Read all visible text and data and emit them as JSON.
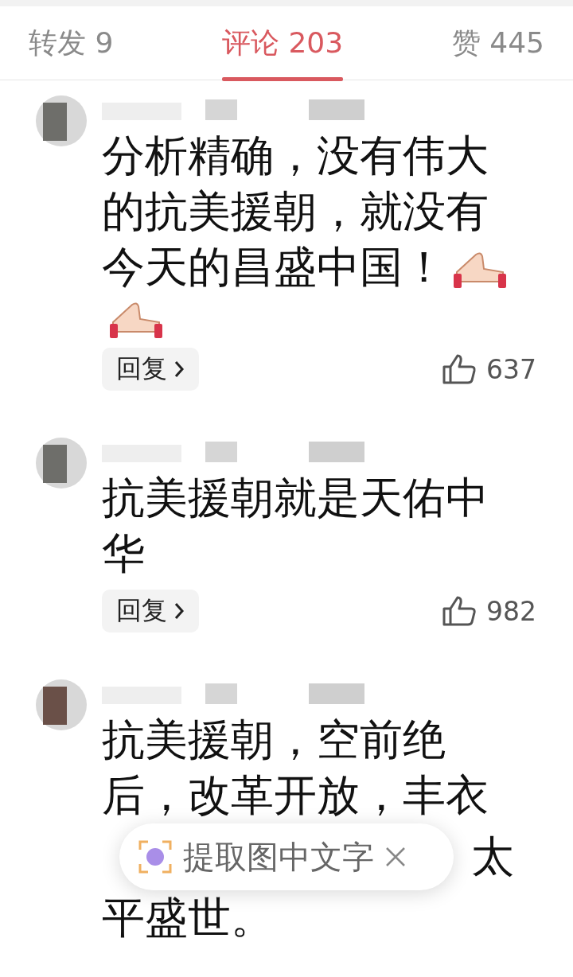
{
  "tabs": [
    {
      "label": "转发 9",
      "selected": false
    },
    {
      "label": "评论 203",
      "selected": true
    },
    {
      "label": "赞 445",
      "selected": false
    }
  ],
  "comments": [
    {
      "lines": [
        {
          "kind": "text",
          "text": "分析精确，没有伟大",
          "emoji": false
        },
        {
          "kind": "text",
          "text": "的抗美援朝，就没有",
          "emoji": false
        },
        {
          "kind": "text",
          "text": "今天的昌盛中国！",
          "emoji": true
        },
        {
          "kind": "emoji"
        }
      ],
      "reply": "回复",
      "likes": "637"
    },
    {
      "lines": [
        {
          "kind": "text",
          "text": "抗美援朝就是天佑中",
          "emoji": false
        },
        {
          "kind": "text",
          "text": "华",
          "emoji": false
        }
      ],
      "reply": "回复",
      "likes": "982"
    },
    {
      "lines": [
        {
          "kind": "text",
          "text": "抗美援朝，空前绝",
          "emoji": false
        },
        {
          "kind": "text",
          "text": "后，改革开放，丰衣",
          "emoji": false
        },
        {
          "kind": "right",
          "text": "太"
        },
        {
          "kind": "text",
          "text": "平盛世。",
          "emoji": false
        }
      ]
    }
  ],
  "popup": {
    "label": "提取图中文字"
  }
}
